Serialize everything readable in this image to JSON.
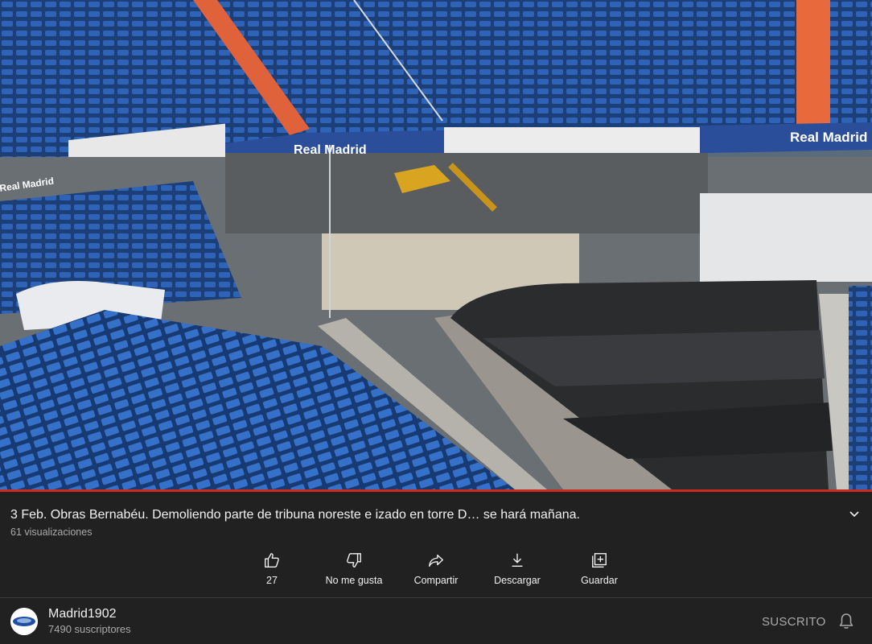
{
  "video": {
    "banner_texts": [
      "Real Madrid",
      "Real Madrid",
      "Real Madrid"
    ],
    "progress_fraction": 1.0,
    "progress_color": "#cc2a1f"
  },
  "info": {
    "title": "3 Feb. Obras Bernabéu. Demoliendo parte de tribuna noreste e izado en torre D… se hará mañana.",
    "views": "61 visualizaciones",
    "expand_icon": "chevron-down-icon"
  },
  "actions": [
    {
      "icon": "thumbs-up-icon",
      "label": "27"
    },
    {
      "icon": "thumbs-down-icon",
      "label": "No me gusta"
    },
    {
      "icon": "share-icon",
      "label": "Compartir"
    },
    {
      "icon": "download-icon",
      "label": "Descargar"
    },
    {
      "icon": "save-icon",
      "label": "Guardar"
    }
  ],
  "channel": {
    "name": "Madrid1902",
    "subscribers": "7490 suscriptores",
    "subscribe_label": "SUSCRITO",
    "notification_icon": "bell-icon"
  },
  "colors": {
    "background": "#212121",
    "seat_blue": "#2f5fb0",
    "secondary_text": "#aaaaaa"
  }
}
